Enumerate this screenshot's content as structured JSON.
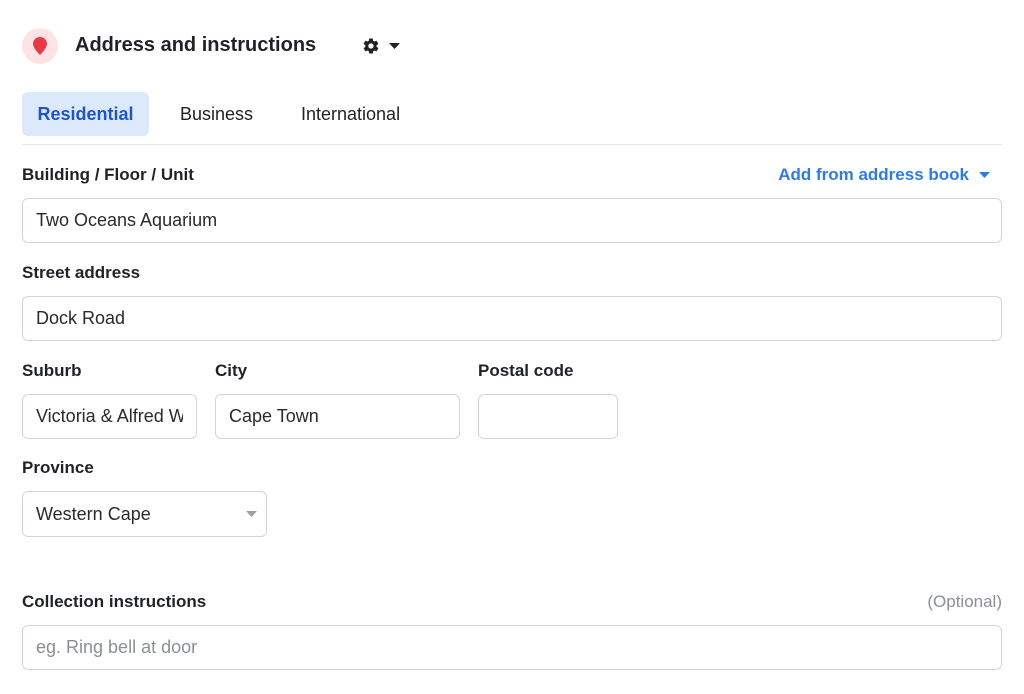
{
  "header": {
    "title": "Address and instructions",
    "icon": "map-pin-icon",
    "settings_icon": "gear-icon",
    "accent_color": "#e6394b"
  },
  "tabs": [
    {
      "label": "Residential",
      "active": true
    },
    {
      "label": "Business",
      "active": false
    },
    {
      "label": "International",
      "active": false
    }
  ],
  "building": {
    "label": "Building / Floor / Unit",
    "value": "Two Oceans Aquarium",
    "address_book_link": "Add from address book"
  },
  "street": {
    "label": "Street address",
    "value": "Dock Road"
  },
  "suburb": {
    "label": "Suburb",
    "value": "Victoria & Alfred Waterfront"
  },
  "city": {
    "label": "City",
    "value": "Cape Town"
  },
  "postal": {
    "label": "Postal code",
    "value": ""
  },
  "province": {
    "label": "Province",
    "value": "Western Cape"
  },
  "instructions": {
    "label": "Collection instructions",
    "optional": "(Optional)",
    "placeholder": "eg. Ring bell at door",
    "value": ""
  }
}
